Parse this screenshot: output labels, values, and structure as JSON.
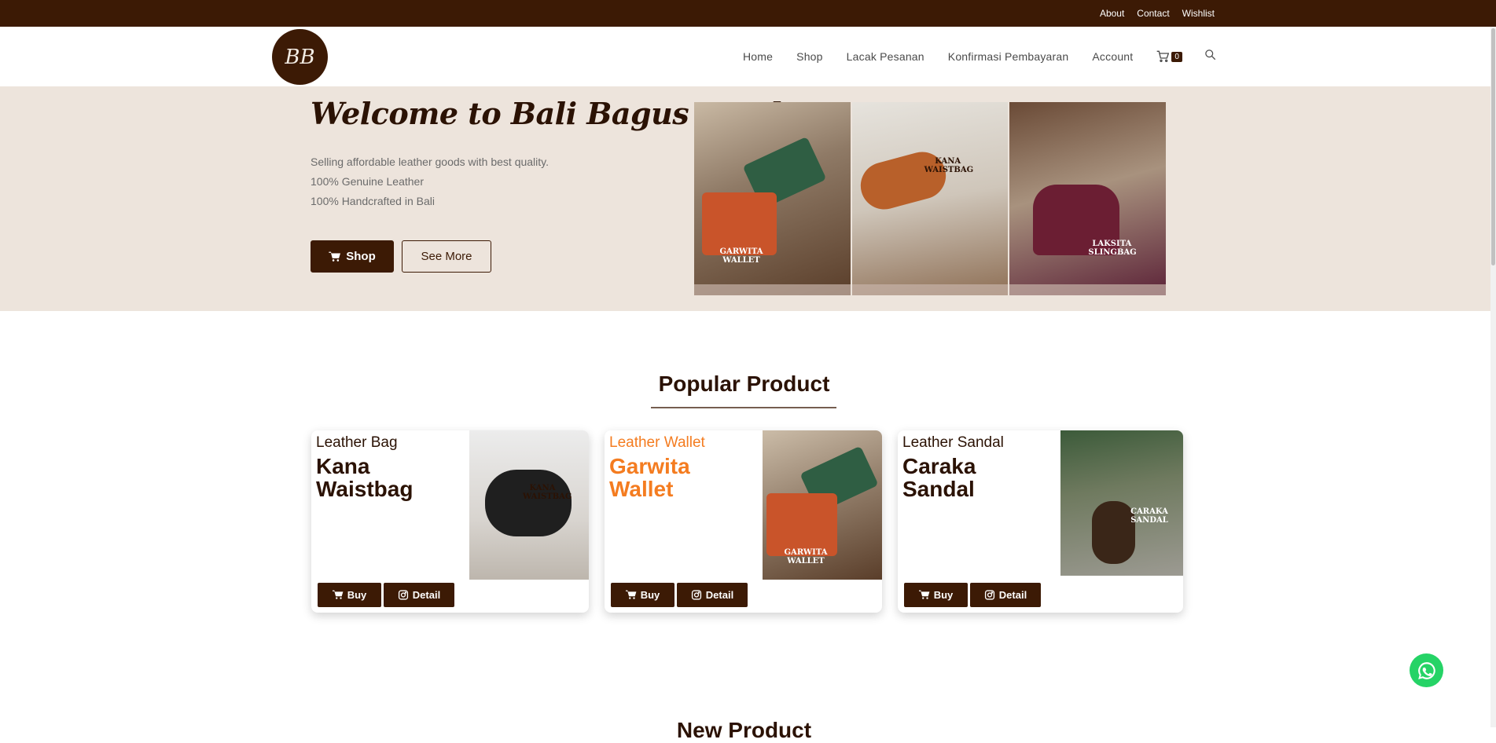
{
  "topbar": {
    "links": [
      "About",
      "Contact",
      "Wishlist"
    ]
  },
  "logo": {
    "text": "BB"
  },
  "nav": {
    "items": [
      "Home",
      "Shop",
      "Lacak Pesanan",
      "Konfirmasi Pembayaran",
      "Account"
    ],
    "cart_count": "0"
  },
  "hero": {
    "title": "Welcome to Bali Bagus Leather",
    "lines": [
      "Selling affordable leather goods with best quality.",
      "100% Genuine Leather",
      "100% Handcrafted in Bali"
    ],
    "shop_label": "Shop",
    "more_label": "See More",
    "captions": [
      "GARWITA WALLET",
      "KANA WAISTBAG",
      "LAKSITA SLINGBAG"
    ]
  },
  "popular": {
    "title": "Popular Product",
    "products": [
      {
        "category": "Leather Bag",
        "name": "Kana Waistbag",
        "img_caption": "KANA WAISTBAG",
        "highlighted": false
      },
      {
        "category": "Leather Wallet",
        "name": "Garwita Wallet",
        "img_caption": "GARWITA WALLET",
        "highlighted": true
      },
      {
        "category": "Leather Sandal",
        "name": "Caraka Sandal",
        "img_caption": "CARAKA SANDAL",
        "highlighted": false
      }
    ],
    "buy_label": "Buy",
    "detail_label": "Detail"
  },
  "next_section": {
    "title": "New Product"
  },
  "colors": {
    "brand": "#3c1a05",
    "accent": "#f47c20",
    "hero_bg": "#ede4dc",
    "whatsapp": "#25d366"
  }
}
